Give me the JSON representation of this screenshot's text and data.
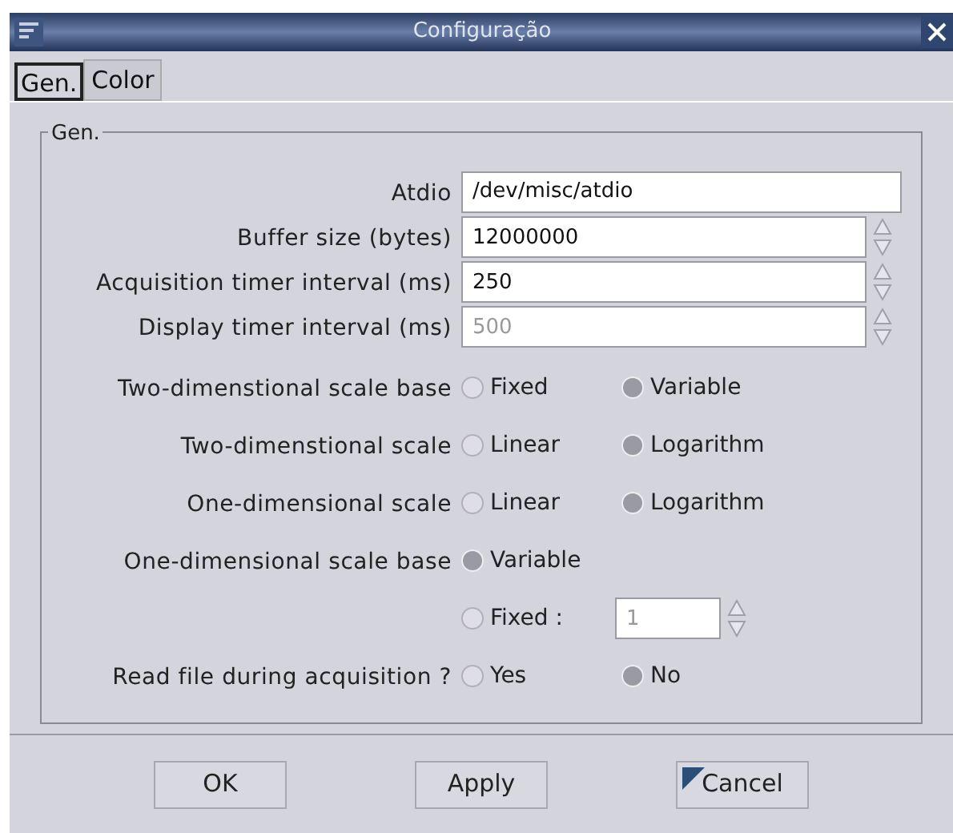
{
  "window": {
    "title": "Configuração"
  },
  "tabs": [
    {
      "label": "Gen.",
      "selected": true
    },
    {
      "label": "Color",
      "selected": false
    }
  ],
  "group": {
    "title": "Gen."
  },
  "rows": [
    {
      "kind": "text",
      "label": "Atdio",
      "value": "/dev/misc/atdio",
      "disabled": false
    },
    {
      "kind": "spin",
      "label": "Buffer size (bytes)",
      "value": "12000000",
      "disabled": false
    },
    {
      "kind": "spin",
      "label": "Acquisition timer interval (ms)",
      "value": "250",
      "disabled": false
    },
    {
      "kind": "spin",
      "label": "Display timer interval (ms)",
      "value": "500",
      "disabled": true
    },
    {
      "kind": "radio",
      "label": "Two-dimenstional scale base",
      "options": [
        {
          "label": "Fixed",
          "selected": false
        },
        {
          "label": "Variable",
          "selected": true
        }
      ]
    },
    {
      "kind": "radio",
      "label": "Two-dimenstional scale",
      "options": [
        {
          "label": "Linear",
          "selected": false
        },
        {
          "label": "Logarithm",
          "selected": true
        }
      ]
    },
    {
      "kind": "radio",
      "label": "One-dimensional scale",
      "options": [
        {
          "label": "Linear",
          "selected": false
        },
        {
          "label": "Logarithm",
          "selected": true
        }
      ]
    },
    {
      "kind": "radio",
      "label": "One-dimensional scale base",
      "options": [
        {
          "label": "Variable",
          "selected": true
        }
      ]
    },
    {
      "kind": "radio_spin",
      "options": [
        {
          "label": "Fixed :",
          "selected": false
        }
      ],
      "value": "1",
      "disabled": true
    },
    {
      "kind": "radio",
      "label": "Read file during acquisition ?",
      "options": [
        {
          "label": "Yes",
          "selected": false
        },
        {
          "label": "No",
          "selected": true
        }
      ]
    }
  ],
  "buttons": [
    {
      "label": "OK",
      "kind": "plain"
    },
    {
      "label": "Apply",
      "kind": "plain"
    },
    {
      "label": "Cancel",
      "kind": "flagged"
    }
  ]
}
